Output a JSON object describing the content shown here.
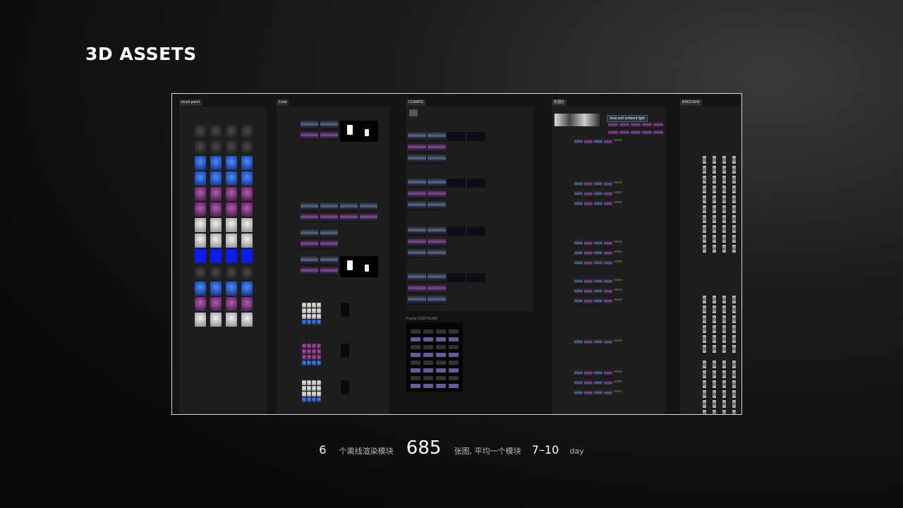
{
  "title": "3D ASSETS",
  "columns": [
    {
      "label": "touch panel"
    },
    {
      "label": "Fond"
    },
    {
      "label": "CLIMATE"
    },
    {
      "label": "氛围灯"
    },
    {
      "label": "BIRDVIEW"
    }
  ],
  "seat_tag": "Seat and ambient light",
  "frame_label": "Frame 2133701289",
  "footer": {
    "modules_count": "6",
    "modules_text": "个离线渲染模块",
    "images_count": "685",
    "images_text": "张图, 平均一个模块",
    "days_range": "7–10",
    "days_unit": "day"
  },
  "colors": {
    "accent_blue": "#1d4fd8",
    "accent_purple": "#7a2f7a",
    "accent_silver": "#c8c8cc",
    "panel_bg": "#1e1e1e"
  }
}
